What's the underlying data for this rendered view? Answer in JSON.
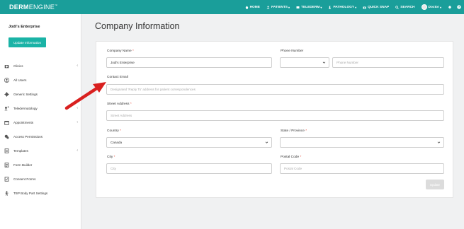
{
  "brand": {
    "name_bold": "DERM",
    "name_rest": "ENGINE",
    "tm": "™"
  },
  "topnav": {
    "items": [
      {
        "label": "HOME",
        "icon": "home-icon"
      },
      {
        "label": "PATIENTS",
        "icon": "patients-icon",
        "caret": "▾"
      },
      {
        "label": "TELEDERM",
        "icon": "telederm-icon",
        "caret": "▾"
      },
      {
        "label": "PATHOLOGY",
        "icon": "pathology-icon",
        "caret": "▾"
      },
      {
        "label": "QUICK SNAP",
        "icon": "camera-icon"
      },
      {
        "label": "SEARCH",
        "icon": "search-icon"
      }
    ],
    "user_label": "Doctor",
    "user_caret": "▾"
  },
  "sidebar": {
    "org_name": "Jodi's Enterprise",
    "update_button": "Update Information",
    "items": [
      {
        "label": "Clinics",
        "icon": "clinic-icon",
        "chevron": "‹"
      },
      {
        "label": "All Users",
        "icon": "users-icon"
      },
      {
        "label": "Generic Settings",
        "icon": "gear-icon"
      },
      {
        "label": "Teledermatology",
        "icon": "telederm-icon",
        "chevron": "‹"
      },
      {
        "label": "Appointments",
        "icon": "calendar-icon",
        "chevron": "‹"
      },
      {
        "label": "Access Permissions",
        "icon": "permissions-icon"
      },
      {
        "label": "Templates",
        "icon": "templates-icon",
        "chevron": "‹"
      },
      {
        "label": "Form Builder",
        "icon": "form-icon"
      },
      {
        "label": "Consent Forms",
        "icon": "consent-icon"
      },
      {
        "label": "TBP Body Part Settings",
        "icon": "body-icon"
      }
    ]
  },
  "main": {
    "title": "Company Information",
    "fields": {
      "company_name": {
        "label": "Company Name",
        "required": "*",
        "value": "Jodi's Enterprise"
      },
      "phone_number": {
        "label": "Phone Number",
        "placeholder": "Phone Number"
      },
      "contact_email": {
        "label": "Contact Email",
        "placeholder": "Designated 'Reply To' address for patient correspondences"
      },
      "street_address": {
        "label": "Street Address",
        "required": "*",
        "placeholder": "Street Address"
      },
      "country": {
        "label": "Country",
        "required": "*",
        "value": "Canada"
      },
      "state": {
        "label": "State / Province",
        "required": "*",
        "value": ""
      },
      "city": {
        "label": "City",
        "required": "*",
        "placeholder": "City"
      },
      "postal_code": {
        "label": "Postal Code",
        "required": "*",
        "placeholder": "Postal Code"
      }
    },
    "update_button": "Update"
  },
  "colors": {
    "topbar": "#1a9e9a",
    "accent": "#1ab3a6",
    "arrow": "#d9201f"
  }
}
